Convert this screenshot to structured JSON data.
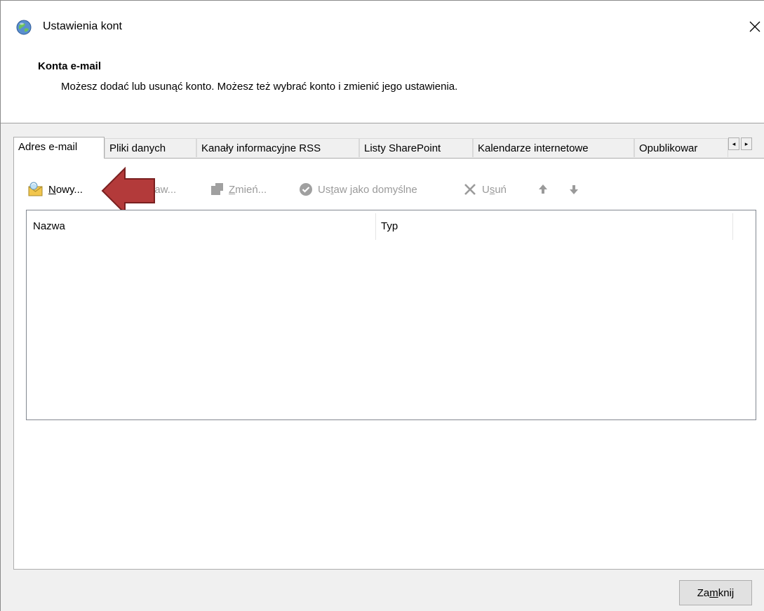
{
  "window": {
    "title": "Ustawienia kont",
    "close_glyph": "✕"
  },
  "header": {
    "heading": "Konta e-mail",
    "description": "Możesz dodać lub usunąć konto. Możesz też wybrać konto i zmienić jego ustawienia."
  },
  "tabs": [
    {
      "label": "Adres e-mail",
      "active": true
    },
    {
      "label": "Pliki danych",
      "active": false
    },
    {
      "label": "Kanały informacyjne RSS",
      "active": false
    },
    {
      "label": "Listy SharePoint",
      "active": false
    },
    {
      "label": "Kalendarze internetowe",
      "active": false
    },
    {
      "label": "Opublikowar",
      "active": false
    }
  ],
  "tab_scroll": {
    "left": "◂",
    "right": "▸"
  },
  "toolbar": {
    "new": {
      "pre": "",
      "key": "N",
      "post": "owy...",
      "icon": "new-account-icon"
    },
    "repair": {
      "pre": "",
      "key": "",
      "post": "praw...",
      "icon": "repair-icon",
      "hidden_part": "Na"
    },
    "change": {
      "pre": "",
      "key": "Z",
      "post": "mień...",
      "icon": "change-icon"
    },
    "default": {
      "pre": "Us",
      "key": "t",
      "post": "aw jako domyślne",
      "icon": "check-circle-icon"
    },
    "remove": {
      "pre": "U",
      "key": "s",
      "post": "uń",
      "icon": "delete-x-icon"
    },
    "up": {
      "icon": "arrow-up-icon"
    },
    "down": {
      "icon": "arrow-down-icon"
    }
  },
  "list": {
    "columns": [
      "Nazwa",
      "Typ"
    ],
    "rows": []
  },
  "footer": {
    "close": {
      "pre": "Za",
      "key": "m",
      "post": "knij"
    }
  },
  "colors": {
    "annotation_arrow": "#b33a3a",
    "annotation_arrow_border": "#7a2020"
  }
}
